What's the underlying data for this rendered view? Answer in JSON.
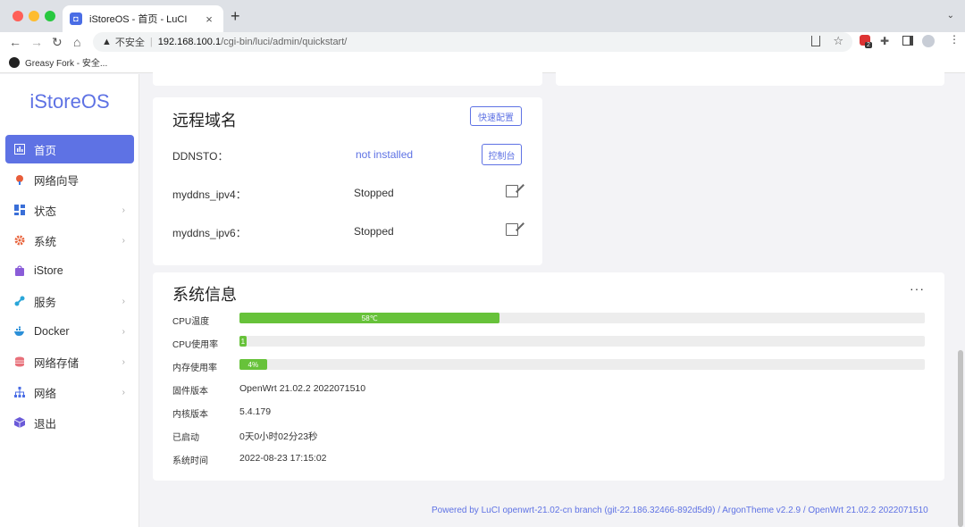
{
  "browser": {
    "tab_title": "iStoreOS - 首页 - LuCI",
    "url_warning": "不安全",
    "url_host": "192.168.100.1",
    "url_path": "/cgi-bin/luci/admin/quickstart/",
    "ext_badge": "2",
    "bookmark_label": "Greasy Fork - 安全..."
  },
  "sidebar": {
    "brand": "iStoreOS",
    "accent_color": "#5e72e4",
    "items": [
      {
        "label": "首页",
        "icon": "dashboard-icon",
        "active": true,
        "chevron": false
      },
      {
        "label": "网络向导",
        "icon": "wizard-icon",
        "active": false,
        "chevron": false
      },
      {
        "label": "状态",
        "icon": "status-icon",
        "active": false,
        "chevron": true
      },
      {
        "label": "系统",
        "icon": "gear-icon",
        "active": false,
        "chevron": true
      },
      {
        "label": "iStore",
        "icon": "store-icon",
        "active": false,
        "chevron": false
      },
      {
        "label": "服务",
        "icon": "services-icon",
        "active": false,
        "chevron": true
      },
      {
        "label": "Docker",
        "icon": "docker-icon",
        "active": false,
        "chevron": true
      },
      {
        "label": "网络存储",
        "icon": "storage-icon",
        "active": false,
        "chevron": true
      },
      {
        "label": "网络",
        "icon": "network-icon",
        "active": false,
        "chevron": true
      },
      {
        "label": "退出",
        "icon": "logout-icon",
        "active": false,
        "chevron": false
      }
    ]
  },
  "remote_domain": {
    "title": "远程域名",
    "quick_config_label": "快速配置",
    "rows": [
      {
        "label": "DDNSTO：",
        "value": "not installed",
        "action": "控制台"
      },
      {
        "label": "myddns_ipv4：",
        "value": "Stopped"
      },
      {
        "label": "myddns_ipv6：",
        "value": "Stopped"
      }
    ]
  },
  "system_info": {
    "title": "系统信息",
    "more": "···",
    "bars": [
      {
        "label": "CPU温度",
        "text": "58℃",
        "percent": 38
      },
      {
        "label": "CPU使用率",
        "text": "1",
        "percent": 1
      },
      {
        "label": "内存使用率",
        "text": "4%",
        "percent": 4
      }
    ],
    "rows": [
      {
        "label": "固件版本",
        "value": "OpenWrt 21.02.2 2022071510"
      },
      {
        "label": "内核版本",
        "value": "5.4.179"
      },
      {
        "label": "已启动",
        "value": "0天0小时02分23秒"
      },
      {
        "label": "系统时间",
        "value": "2022-08-23 17:15:02"
      }
    ]
  },
  "footer": {
    "text": "Powered by LuCI openwrt-21.02-cn branch (git-22.186.32466-892d5d9) / ArgonTheme v2.2.9 / OpenWrt 21.02.2 2022071510"
  },
  "colors": {
    "accent": "#5e72e4",
    "progress": "#67c23a"
  }
}
